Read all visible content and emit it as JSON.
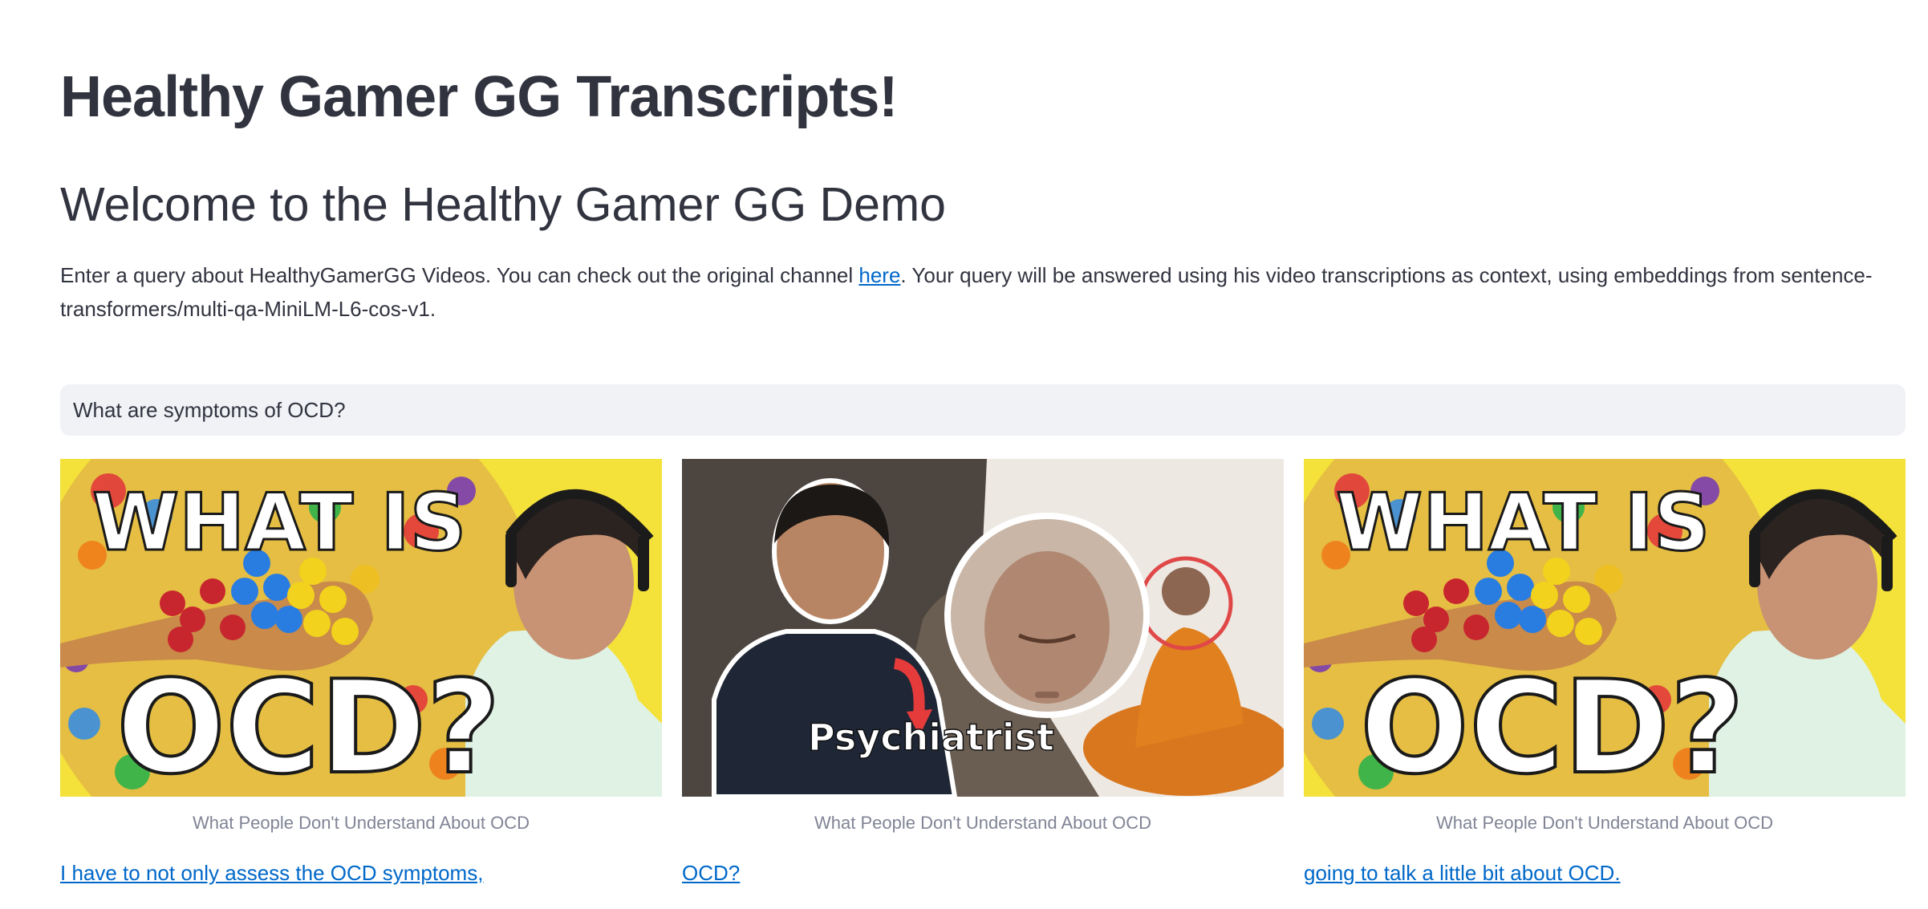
{
  "page": {
    "title": "Healthy Gamer GG Transcripts!",
    "subtitle": "Welcome to the Healthy Gamer GG Demo",
    "intro": {
      "before_link": "Enter a query about HealthyGamerGG Videos. You can check out the original channel ",
      "link_text": "here",
      "after_link": ". Your query will be answered using his video transcriptions as context, using embeddings from sentence-transformers/multi-qa-MiniLM-L6-cos-v1."
    },
    "query": {
      "value": "What are symptoms of OCD?"
    }
  },
  "results": [
    {
      "thumbnail_text": [
        "WHAT IS",
        "OCD?"
      ],
      "caption": "What People Don't Understand About OCD",
      "snippet": "I have to not only assess the OCD symptoms,"
    },
    {
      "thumbnail_text": [
        "Psychiatrist"
      ],
      "caption": "What People Don't Understand About OCD",
      "snippet": "OCD?"
    },
    {
      "thumbnail_text": [
        "WHAT IS",
        "OCD?"
      ],
      "caption": "What People Don't Understand About OCD",
      "snippet": "going to talk a little bit about OCD."
    }
  ],
  "colors": {
    "text": "#31333f",
    "link": "#0068c9",
    "input_bg": "#f0f2f6",
    "caption": "#808495"
  }
}
